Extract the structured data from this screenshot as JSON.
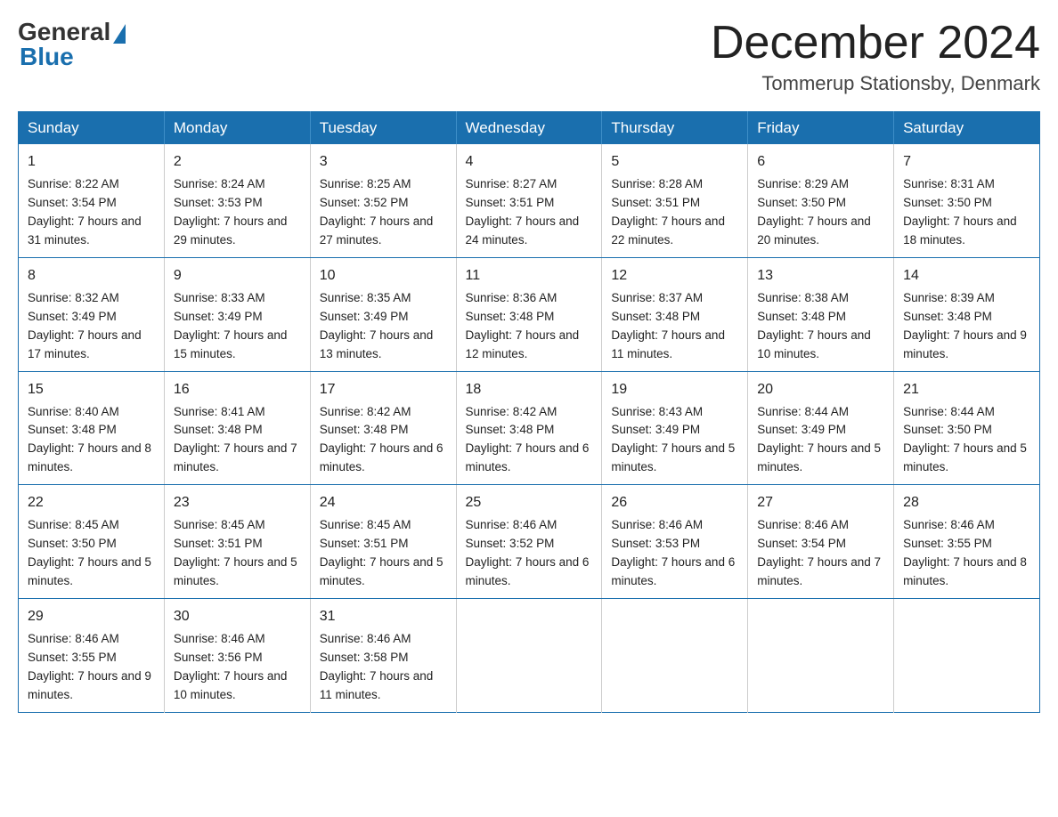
{
  "logo": {
    "general": "General",
    "blue": "Blue"
  },
  "title": {
    "month": "December 2024",
    "location": "Tommerup Stationsby, Denmark"
  },
  "weekdays": [
    "Sunday",
    "Monday",
    "Tuesday",
    "Wednesday",
    "Thursday",
    "Friday",
    "Saturday"
  ],
  "weeks": [
    [
      {
        "day": "1",
        "sunrise": "8:22 AM",
        "sunset": "3:54 PM",
        "daylight": "7 hours and 31 minutes."
      },
      {
        "day": "2",
        "sunrise": "8:24 AM",
        "sunset": "3:53 PM",
        "daylight": "7 hours and 29 minutes."
      },
      {
        "day": "3",
        "sunrise": "8:25 AM",
        "sunset": "3:52 PM",
        "daylight": "7 hours and 27 minutes."
      },
      {
        "day": "4",
        "sunrise": "8:27 AM",
        "sunset": "3:51 PM",
        "daylight": "7 hours and 24 minutes."
      },
      {
        "day": "5",
        "sunrise": "8:28 AM",
        "sunset": "3:51 PM",
        "daylight": "7 hours and 22 minutes."
      },
      {
        "day": "6",
        "sunrise": "8:29 AM",
        "sunset": "3:50 PM",
        "daylight": "7 hours and 20 minutes."
      },
      {
        "day": "7",
        "sunrise": "8:31 AM",
        "sunset": "3:50 PM",
        "daylight": "7 hours and 18 minutes."
      }
    ],
    [
      {
        "day": "8",
        "sunrise": "8:32 AM",
        "sunset": "3:49 PM",
        "daylight": "7 hours and 17 minutes."
      },
      {
        "day": "9",
        "sunrise": "8:33 AM",
        "sunset": "3:49 PM",
        "daylight": "7 hours and 15 minutes."
      },
      {
        "day": "10",
        "sunrise": "8:35 AM",
        "sunset": "3:49 PM",
        "daylight": "7 hours and 13 minutes."
      },
      {
        "day": "11",
        "sunrise": "8:36 AM",
        "sunset": "3:48 PM",
        "daylight": "7 hours and 12 minutes."
      },
      {
        "day": "12",
        "sunrise": "8:37 AM",
        "sunset": "3:48 PM",
        "daylight": "7 hours and 11 minutes."
      },
      {
        "day": "13",
        "sunrise": "8:38 AM",
        "sunset": "3:48 PM",
        "daylight": "7 hours and 10 minutes."
      },
      {
        "day": "14",
        "sunrise": "8:39 AM",
        "sunset": "3:48 PM",
        "daylight": "7 hours and 9 minutes."
      }
    ],
    [
      {
        "day": "15",
        "sunrise": "8:40 AM",
        "sunset": "3:48 PM",
        "daylight": "7 hours and 8 minutes."
      },
      {
        "day": "16",
        "sunrise": "8:41 AM",
        "sunset": "3:48 PM",
        "daylight": "7 hours and 7 minutes."
      },
      {
        "day": "17",
        "sunrise": "8:42 AM",
        "sunset": "3:48 PM",
        "daylight": "7 hours and 6 minutes."
      },
      {
        "day": "18",
        "sunrise": "8:42 AM",
        "sunset": "3:48 PM",
        "daylight": "7 hours and 6 minutes."
      },
      {
        "day": "19",
        "sunrise": "8:43 AM",
        "sunset": "3:49 PM",
        "daylight": "7 hours and 5 minutes."
      },
      {
        "day": "20",
        "sunrise": "8:44 AM",
        "sunset": "3:49 PM",
        "daylight": "7 hours and 5 minutes."
      },
      {
        "day": "21",
        "sunrise": "8:44 AM",
        "sunset": "3:50 PM",
        "daylight": "7 hours and 5 minutes."
      }
    ],
    [
      {
        "day": "22",
        "sunrise": "8:45 AM",
        "sunset": "3:50 PM",
        "daylight": "7 hours and 5 minutes."
      },
      {
        "day": "23",
        "sunrise": "8:45 AM",
        "sunset": "3:51 PM",
        "daylight": "7 hours and 5 minutes."
      },
      {
        "day": "24",
        "sunrise": "8:45 AM",
        "sunset": "3:51 PM",
        "daylight": "7 hours and 5 minutes."
      },
      {
        "day": "25",
        "sunrise": "8:46 AM",
        "sunset": "3:52 PM",
        "daylight": "7 hours and 6 minutes."
      },
      {
        "day": "26",
        "sunrise": "8:46 AM",
        "sunset": "3:53 PM",
        "daylight": "7 hours and 6 minutes."
      },
      {
        "day": "27",
        "sunrise": "8:46 AM",
        "sunset": "3:54 PM",
        "daylight": "7 hours and 7 minutes."
      },
      {
        "day": "28",
        "sunrise": "8:46 AM",
        "sunset": "3:55 PM",
        "daylight": "7 hours and 8 minutes."
      }
    ],
    [
      {
        "day": "29",
        "sunrise": "8:46 AM",
        "sunset": "3:55 PM",
        "daylight": "7 hours and 9 minutes."
      },
      {
        "day": "30",
        "sunrise": "8:46 AM",
        "sunset": "3:56 PM",
        "daylight": "7 hours and 10 minutes."
      },
      {
        "day": "31",
        "sunrise": "8:46 AM",
        "sunset": "3:58 PM",
        "daylight": "7 hours and 11 minutes."
      },
      null,
      null,
      null,
      null
    ]
  ]
}
